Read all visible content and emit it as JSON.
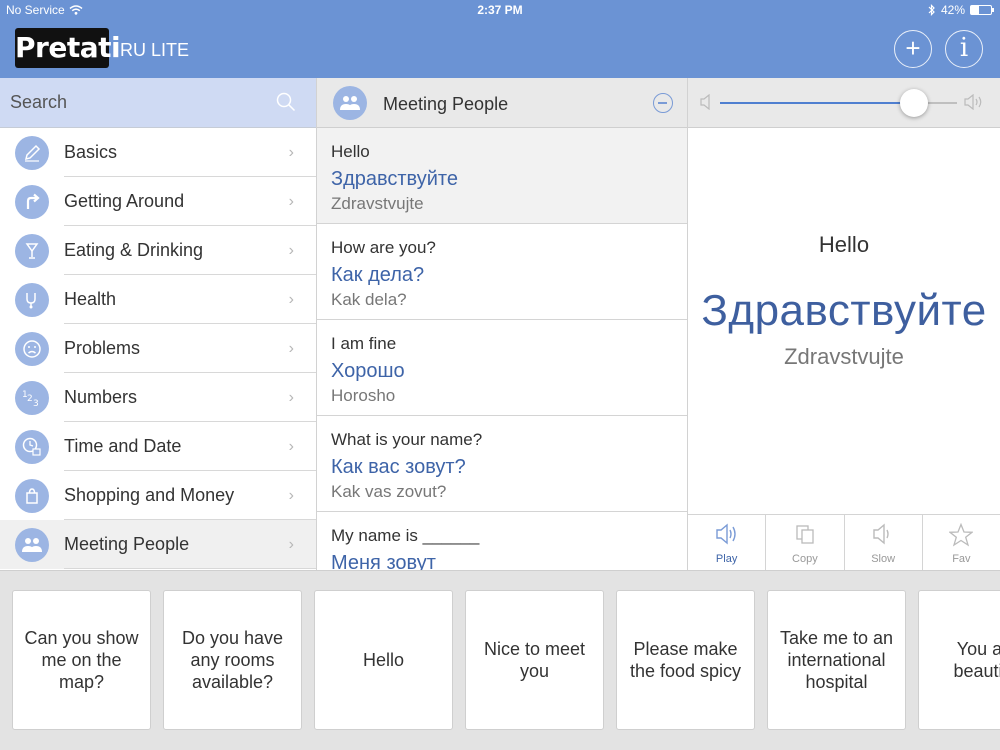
{
  "status": {
    "carrier": "No Service",
    "time": "2:37 PM",
    "battery_text": "42%",
    "battery_level": 0.42
  },
  "app": {
    "logo": "Pretati",
    "subtitle": "RU LITE"
  },
  "search": {
    "placeholder": "Search"
  },
  "categories": [
    {
      "label": "Basics",
      "icon": "pencil-icon"
    },
    {
      "label": "Getting Around",
      "icon": "turn-arrow-icon"
    },
    {
      "label": "Eating & Drinking",
      "icon": "cocktail-icon"
    },
    {
      "label": "Health",
      "icon": "stethoscope-icon"
    },
    {
      "label": "Problems",
      "icon": "sad-face-icon"
    },
    {
      "label": "Numbers",
      "icon": "numbers-123-icon"
    },
    {
      "label": "Time and Date",
      "icon": "clock-calendar-icon"
    },
    {
      "label": "Shopping and Money",
      "icon": "shopping-bag-icon"
    },
    {
      "label": "Meeting People",
      "icon": "people-icon"
    }
  ],
  "middle": {
    "title": "Meeting People",
    "phrases": [
      {
        "en": "Hello",
        "ru": "Здравствуйте",
        "tr": "Zdravstvujte"
      },
      {
        "en": "How are you?",
        "ru": "Как дела?",
        "tr": "Kak dela?"
      },
      {
        "en": "I am fine",
        "ru": "Хорошо",
        "tr": "Horosho"
      },
      {
        "en": "What is your name?",
        "ru": "Как вас зовут?",
        "tr": "Kak vas zovut?"
      },
      {
        "en": "My name is ______",
        "ru": "Меня зовут",
        "tr": ""
      }
    ]
  },
  "detail": {
    "en": "Hello",
    "ru": "Здравствуйте",
    "tr": "Zdravstvujte",
    "volume_level": 0.82
  },
  "actions": [
    {
      "label": "Play",
      "icon": "speaker-icon"
    },
    {
      "label": "Copy",
      "icon": "copy-icon"
    },
    {
      "label": "Slow",
      "icon": "speaker-slow-icon"
    },
    {
      "label": "Fav",
      "icon": "star-icon"
    }
  ],
  "cards": [
    "Can you show me on the map?",
    "Do you have any rooms available?",
    "Hello",
    "Nice to meet you",
    "Please make the food spicy",
    "Take me to an international hospital",
    "You are beautiful"
  ],
  "colors": {
    "header": "#6b93d4",
    "accent": "#3e64a8",
    "icon_bg": "#9cb5e3"
  }
}
